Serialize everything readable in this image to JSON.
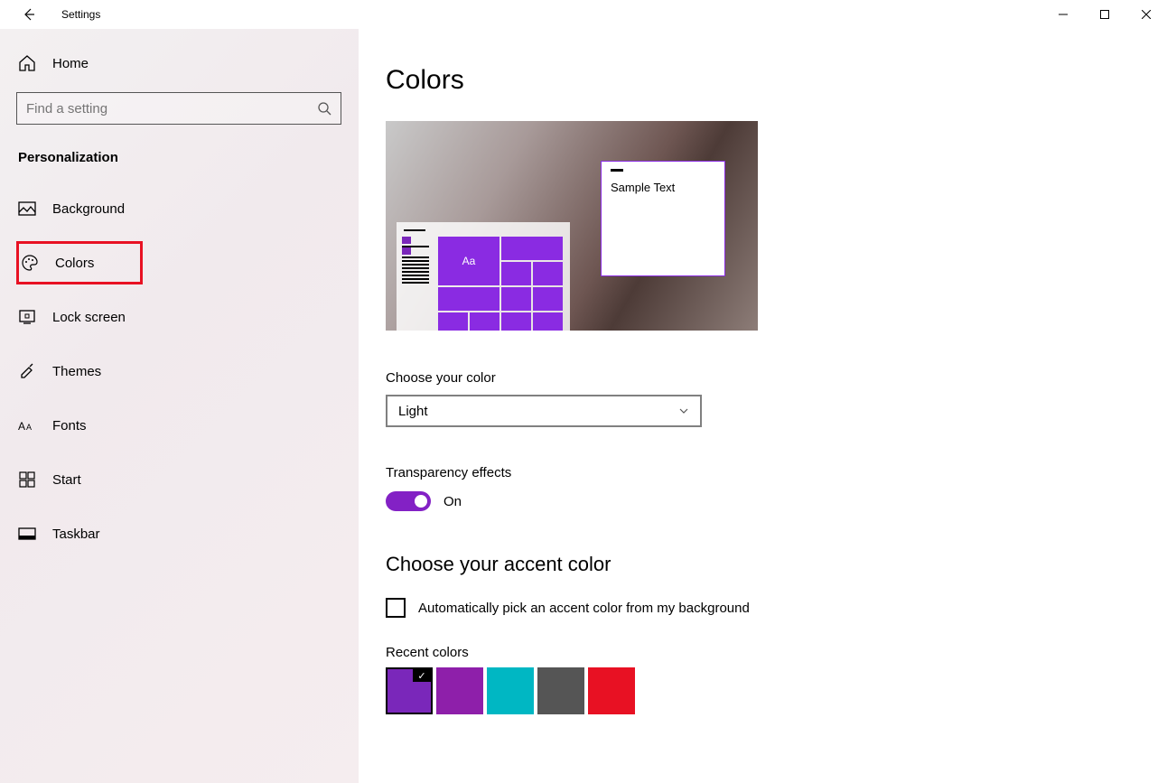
{
  "titlebar": {
    "app_title": "Settings"
  },
  "sidebar": {
    "home": "Home",
    "search_placeholder": "Find a setting",
    "section": "Personalization",
    "items": [
      {
        "label": "Background"
      },
      {
        "label": "Colors"
      },
      {
        "label": "Lock screen"
      },
      {
        "label": "Themes"
      },
      {
        "label": "Fonts"
      },
      {
        "label": "Start"
      },
      {
        "label": "Taskbar"
      }
    ]
  },
  "main": {
    "title": "Colors",
    "preview": {
      "sample_text": "Sample Text",
      "tile_text": "Aa"
    },
    "choose_color": {
      "label": "Choose your color",
      "value": "Light"
    },
    "transparency": {
      "label": "Transparency effects",
      "state": "On"
    },
    "accent": {
      "heading": "Choose your accent color",
      "auto_label": "Automatically pick an accent color from my background",
      "recent_label": "Recent colors",
      "recent": [
        "#7a27ba",
        "#8e1faa",
        "#00b7c3",
        "#555555",
        "#e81123"
      ],
      "selected_index": 0
    }
  }
}
